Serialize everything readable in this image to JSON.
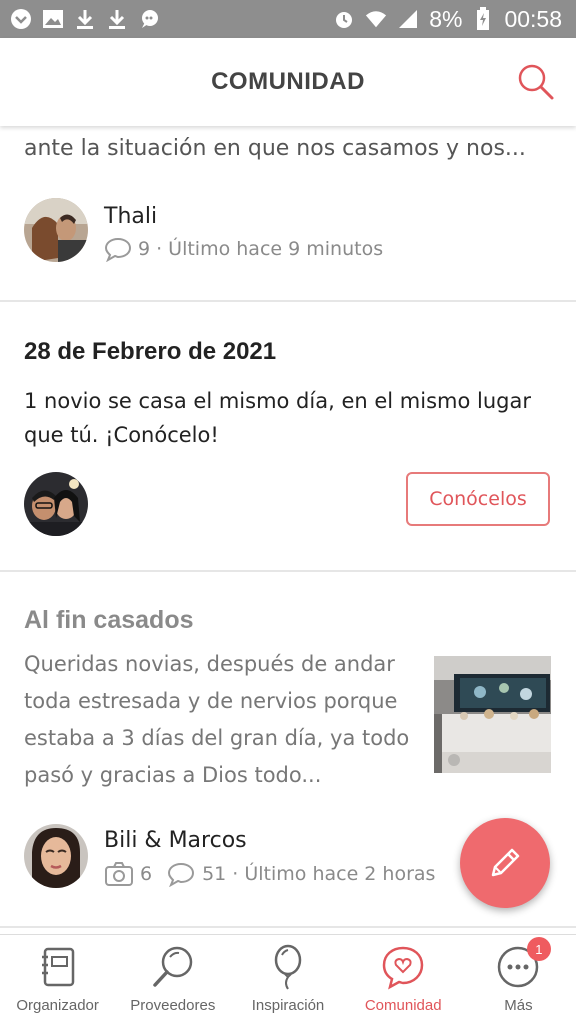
{
  "status_bar": {
    "battery": "8%",
    "time": "00:58",
    "left_icons": [
      "chevron-down-circle-icon",
      "image-icon",
      "download-icon",
      "download-icon",
      "chat-bubble-icon"
    ],
    "right_icons": [
      "alarm-icon",
      "wifi-icon",
      "signal-icon",
      "battery-charging-icon"
    ]
  },
  "header": {
    "title": "COMUNIDAD",
    "search_icon": "search-icon",
    "accent_color": "#e0555a"
  },
  "cards": [
    {
      "snippet": "ante la situación en que nos casamos y nos...",
      "author": "Thali",
      "comments": "9",
      "last": "· Último hace 9 minutos"
    },
    {
      "date": "28 de Febrero de 2021",
      "text": "1 novio se casa el mismo día, en el mismo lugar que tú. ¡Conócelo!",
      "button": "Conócelos"
    },
    {
      "title": "Al fin casados",
      "body": "Queridas novias, después de andar toda estresada y de nervios porque estaba a 3 días del gran día, ya todo pasó y gracias a Dios todo...",
      "author": "Bili & Marcos",
      "photos": "6",
      "comments": "51",
      "last": "· Último hace 2 horas"
    }
  ],
  "fab": {
    "icon": "pencil-icon"
  },
  "bottom_nav": {
    "items": [
      {
        "label": "Organizador",
        "icon": "notebook-icon"
      },
      {
        "label": "Proveedores",
        "icon": "magnifier-icon"
      },
      {
        "label": "Inspiración",
        "icon": "balloon-icon"
      },
      {
        "label": "Comunidad",
        "icon": "heart-bubble-icon",
        "active": true
      },
      {
        "label": "Más",
        "icon": "more-icon",
        "badge": "1"
      }
    ]
  }
}
